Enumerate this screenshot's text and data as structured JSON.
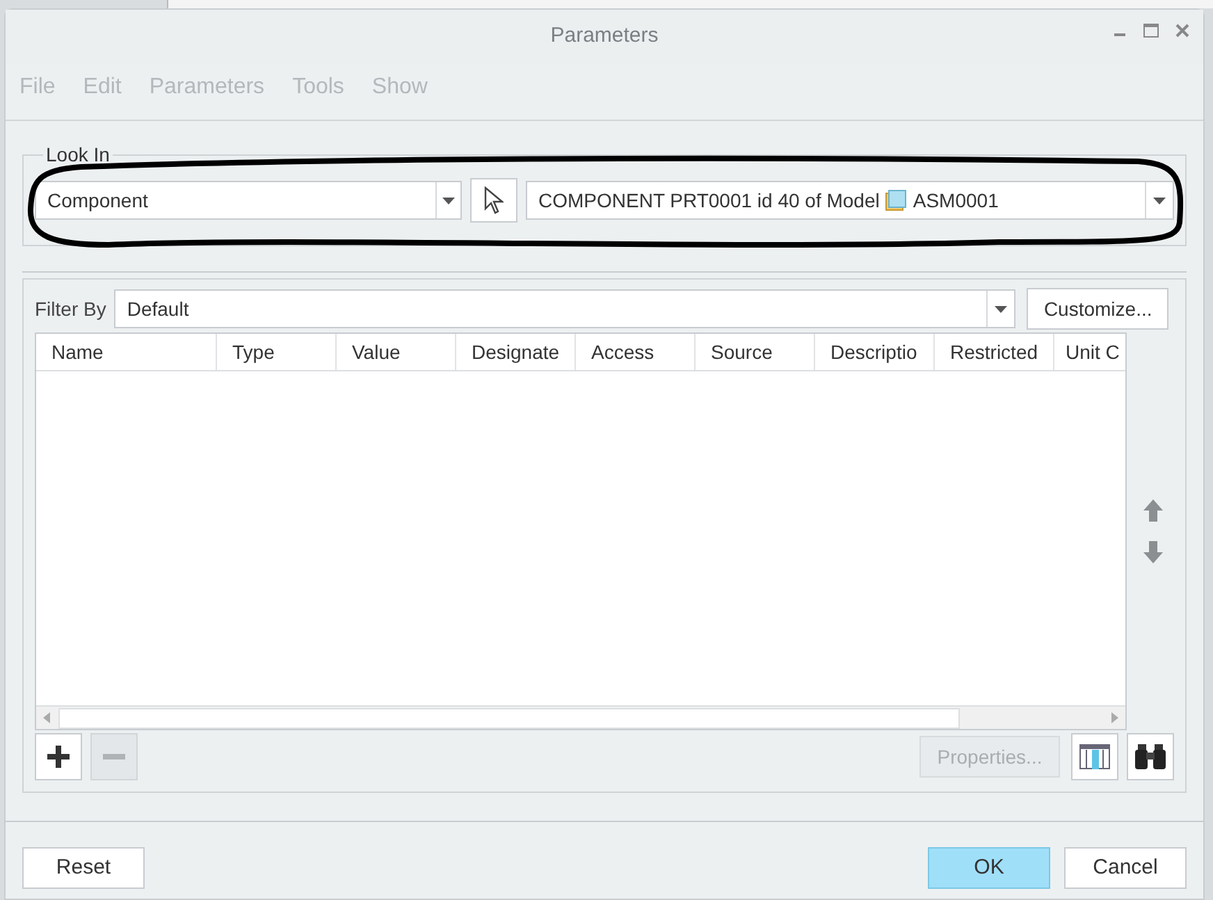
{
  "window": {
    "title": "Parameters"
  },
  "menu": [
    {
      "label": "File",
      "disabled": true
    },
    {
      "label": "Edit",
      "disabled": true
    },
    {
      "label": "Parameters",
      "disabled": true
    },
    {
      "label": "Tools",
      "disabled": true
    },
    {
      "label": "Show",
      "disabled": true
    }
  ],
  "look_in": {
    "label": "Look In",
    "type_value": "Component",
    "item_text": "COMPONENT PRT0001 id 40 of Model",
    "model_name": "ASM0001"
  },
  "filter": {
    "label": "Filter By",
    "value": "Default",
    "customize": "Customize..."
  },
  "table": {
    "columns": [
      "Name",
      "Type",
      "Value",
      "Designate",
      "Access",
      "Source",
      "Descriptio",
      "Restricted",
      "Unit C"
    ]
  },
  "toolbar": {
    "add_disabled": false,
    "remove_disabled": true,
    "properties": {
      "label": "Properties...",
      "disabled": true
    }
  },
  "buttons": [
    {
      "label": "Reset",
      "kind": "plain"
    },
    {
      "label": "OK",
      "kind": "default"
    },
    {
      "label": "Cancel",
      "kind": "plain"
    }
  ]
}
